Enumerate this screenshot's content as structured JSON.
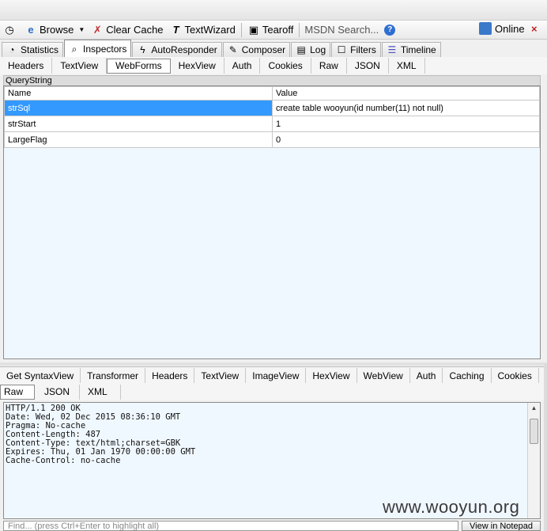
{
  "toolbar": {
    "items": [
      {
        "label": "",
        "icon": "clock-icon"
      },
      {
        "label": "Browse",
        "icon": "ie-icon"
      },
      {
        "label": "Clear Cache",
        "icon": "clear-cache-icon"
      },
      {
        "label": "TextWizard",
        "icon": "textwizard-icon"
      },
      {
        "label": "Tearoff",
        "icon": "tearoff-icon"
      }
    ],
    "search_placeholder": "MSDN Search...",
    "online_label": "Online",
    "close_glyph": "×"
  },
  "main_tabs": [
    {
      "label": "Statistics",
      "icon": "statistics-icon"
    },
    {
      "label": "Inspectors",
      "icon": "inspectors-icon",
      "active": true
    },
    {
      "label": "AutoResponder",
      "icon": "lightning-icon"
    },
    {
      "label": "Composer",
      "icon": "composer-icon"
    },
    {
      "label": "Log",
      "icon": "log-icon"
    },
    {
      "label": "Filters",
      "icon": "filters-checkbox-icon"
    },
    {
      "label": "Timeline",
      "icon": "timeline-icon"
    }
  ],
  "request_tabs": [
    "Headers",
    "TextView",
    "WebForms",
    "HexView",
    "Auth",
    "Cookies",
    "Raw",
    "JSON",
    "XML"
  ],
  "request_active_tab": "WebForms",
  "querystring": {
    "section_label": "QueryString",
    "columns": [
      "Name",
      "Value"
    ],
    "rows": [
      {
        "name": "strSql",
        "value": "create table wooyun(id number(11) not null)",
        "selected": true
      },
      {
        "name": "strStart",
        "value": "1"
      },
      {
        "name": "LargeFlag",
        "value": "0"
      }
    ]
  },
  "response_tabs_row1": [
    "Get SyntaxView",
    "Transformer",
    "Headers",
    "TextView",
    "ImageView",
    "HexView",
    "WebView",
    "Auth",
    "Caching",
    "Cookies"
  ],
  "response_tabs_row2": [
    "Raw",
    "JSON",
    "XML"
  ],
  "response_active_tab": "Raw",
  "response_raw": "HTTP/1.1 200 OK\nDate: Wed, 02 Dec 2015 08:36:10 GMT\nPragma: No-cache\nContent-Length: 487\nContent-Type: text/html;charset=GBK\nExpires: Thu, 01 Jan 1970 00:00:00 GMT\nCache-Control: no-cache",
  "watermark": "www.wooyun.org",
  "find_placeholder": "Find... (press Ctrl+Enter to highlight all)",
  "notepad_button": "View in Notepad"
}
